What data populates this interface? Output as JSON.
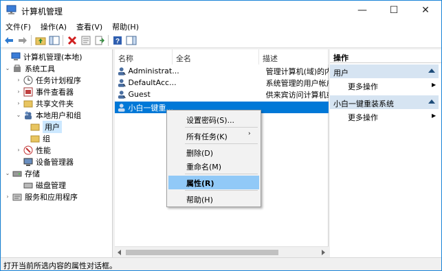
{
  "window": {
    "title": "计算机管理",
    "min_icon": "—",
    "max_icon": "☐",
    "close_icon": "✕"
  },
  "menu": [
    "文件(F)",
    "操作(A)",
    "查看(V)",
    "帮助(H)"
  ],
  "toolbar": {
    "icons": [
      "back-arrow-icon",
      "forward-arrow-icon",
      "up-folder-icon",
      "show-hide-tree-icon",
      "delete-icon",
      "properties-icon",
      "export-icon",
      "help-icon",
      "action-pane-icon"
    ]
  },
  "tree": {
    "root": "计算机管理(本地)",
    "system_tools": "系统工具",
    "task_scheduler": "任务计划程序",
    "event_viewer": "事件查看器",
    "shared_folders": "共享文件夹",
    "local_users": "本地用户和组",
    "users": "用户",
    "groups": "组",
    "performance": "性能",
    "device_manager": "设备管理器",
    "storage": "存储",
    "disk_management": "磁盘管理",
    "services": "服务和应用程序"
  },
  "list": {
    "columns": [
      "名称",
      "全名",
      "描述"
    ],
    "rows": [
      {
        "name": "Administrat...",
        "fullname": "",
        "desc": "管理计算机(域)的内置"
      },
      {
        "name": "DefaultAcc...",
        "fullname": "",
        "desc": "系统管理的用户帐户"
      },
      {
        "name": "Guest",
        "fullname": "",
        "desc": "供来宾访问计算机或"
      },
      {
        "name": "小白一键重...",
        "fullname": "",
        "desc": ""
      }
    ]
  },
  "actions": {
    "header": "操作",
    "section1": "用户",
    "section1_more": "更多操作",
    "section2": "小白一键重装系统",
    "section2_more": "更多操作"
  },
  "context_menu": {
    "set_password": "设置密码(S)...",
    "all_tasks": "所有任务(K)",
    "delete": "删除(D)",
    "rename": "重命名(M)",
    "properties": "属性(R)",
    "help": "帮助(H)",
    "submenu_arrow": "›"
  },
  "status": "打开当前所选内容的属性对话框。",
  "colors": {
    "selection": "#0078d7",
    "menu_highlight": "#91c9f7",
    "action_section": "#d6e4f2"
  }
}
